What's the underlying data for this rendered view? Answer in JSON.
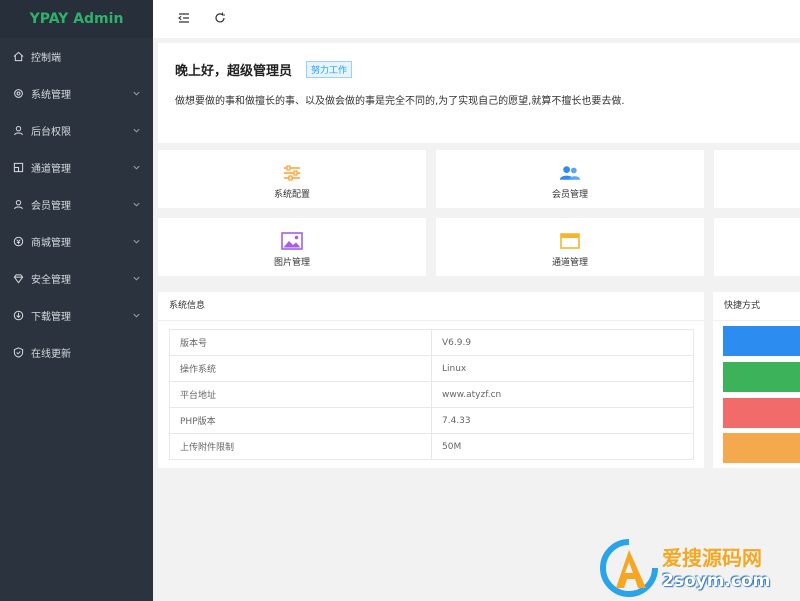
{
  "app": {
    "title": "YPAY Admin"
  },
  "sidebar": {
    "items": [
      {
        "label": "控制端",
        "icon": "home-icon",
        "has_children": false
      },
      {
        "label": "系统管理",
        "icon": "gear-icon",
        "has_children": true
      },
      {
        "label": "后台权限",
        "icon": "user-icon",
        "has_children": true
      },
      {
        "label": "通道管理",
        "icon": "channel-icon",
        "has_children": true
      },
      {
        "label": "会员管理",
        "icon": "user-icon",
        "has_children": true
      },
      {
        "label": "商城管理",
        "icon": "shop-icon",
        "has_children": true
      },
      {
        "label": "安全管理",
        "icon": "diamond-icon",
        "has_children": true
      },
      {
        "label": "下载管理",
        "icon": "download-icon",
        "has_children": true
      },
      {
        "label": "在线更新",
        "icon": "shield-icon",
        "has_children": false
      }
    ]
  },
  "welcome": {
    "greeting": "晚上好，超级管理员",
    "badge": "努力工作",
    "motto": "做想要做的事和做擅长的事、以及做会做的事是完全不同的,为了实现自己的愿望,就算不擅长也要去做."
  },
  "shortcuts": [
    {
      "label": "系统配置",
      "icon": "sliders-icon",
      "color": "#ff9f2d"
    },
    {
      "label": "会员管理",
      "icon": "users-icon",
      "color": "#2d8cf0"
    },
    {
      "label": "图片管理",
      "icon": "image-icon",
      "color": "#a55eea"
    },
    {
      "label": "通道管理",
      "icon": "window-icon",
      "color": "#f7b52c"
    }
  ],
  "system_info": {
    "title": "系统信息",
    "rows": [
      {
        "key": "版本号",
        "value": "V6.9.9"
      },
      {
        "key": "操作系统",
        "value": "Linux"
      },
      {
        "key": "平台地址",
        "value": "www.atyzf.cn"
      },
      {
        "key": "PHP版本",
        "value": "7.4.33"
      },
      {
        "key": "上传附件限制",
        "value": "50M"
      }
    ]
  },
  "quick": {
    "title": "快捷方式",
    "colors": [
      "#2d8cf0",
      "#3cb35a",
      "#f26b6b",
      "#f5a94f"
    ]
  },
  "watermark": {
    "text1": "爱搜源码网",
    "text2": "2soym.com"
  },
  "colors": {
    "sidebar_bg": "#2b333e",
    "logo_green": "#2fb06b",
    "accent": "#1e9fff"
  }
}
